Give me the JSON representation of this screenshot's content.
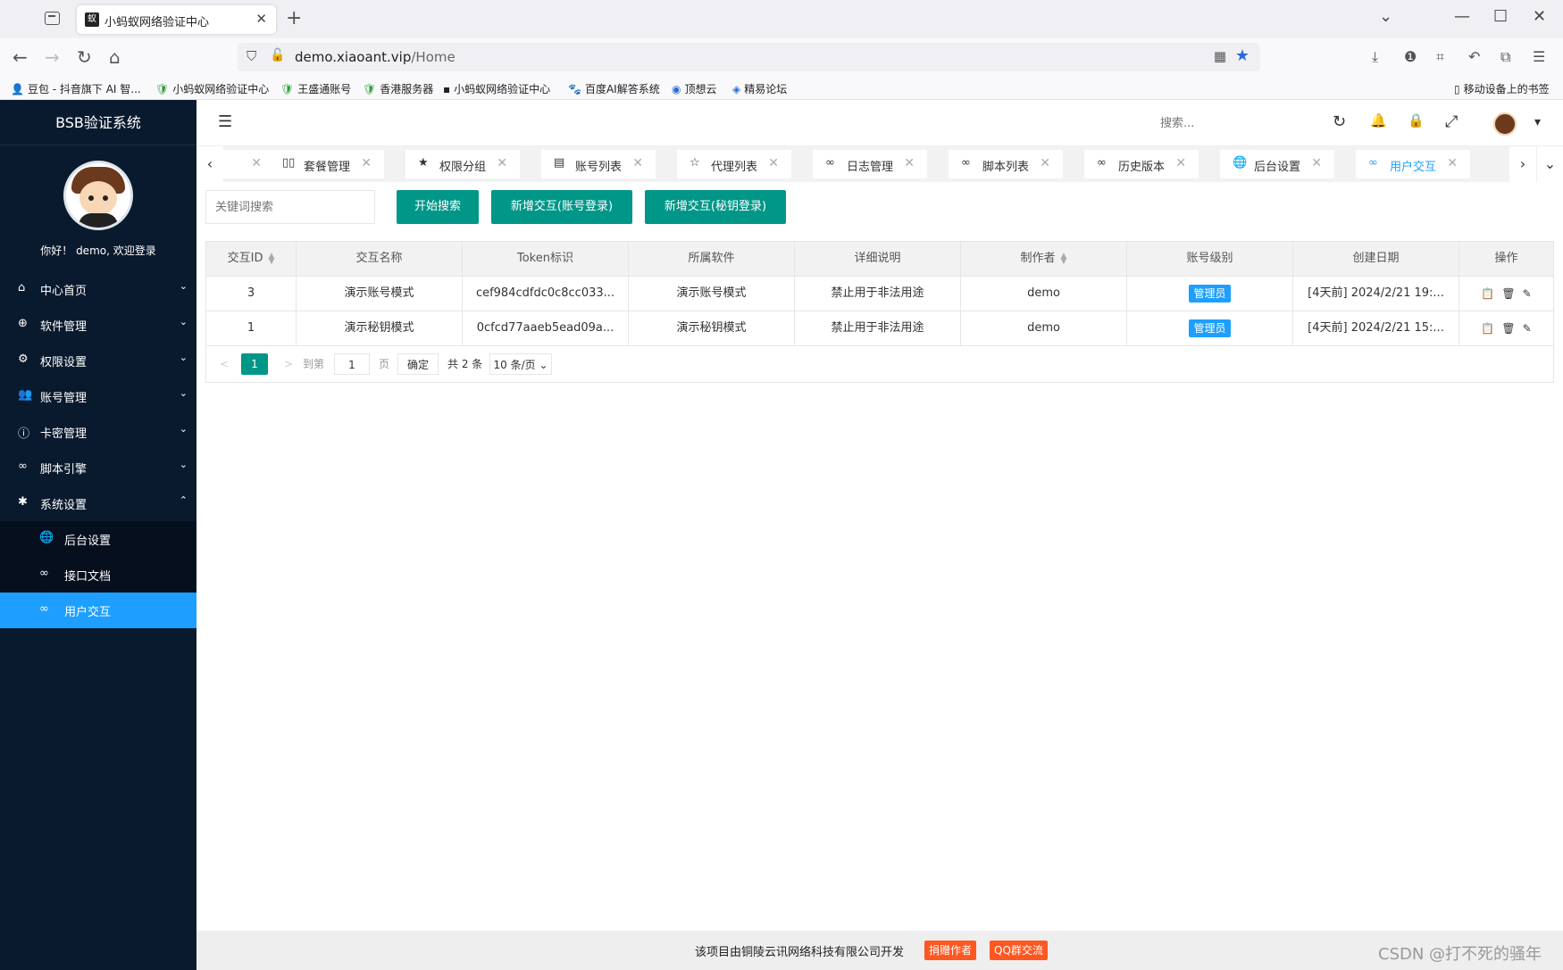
{
  "browser": {
    "tab_title": "小蚂蚁网络验证中心",
    "tab_favicon": "蚁",
    "tab_close": "✕",
    "new_tab": "+",
    "url_host": "demo.xiaoant.vip",
    "url_path": "/Home",
    "bookmarks": [
      {
        "icon": "👤",
        "label": "豆包 - 抖音旗下 AI 智..."
      },
      {
        "icon": "🛡",
        "label": "小蚂蚁网络验证中心"
      },
      {
        "icon": "🛡",
        "label": "王盛通账号"
      },
      {
        "icon": "🛡",
        "label": "香港服务器"
      },
      {
        "icon": "▪",
        "label": "小蚂蚁网络验证中心"
      },
      {
        "icon": "🐾",
        "label": "百度AI解答系统"
      },
      {
        "icon": "◉",
        "label": "顶想云"
      },
      {
        "icon": "◈",
        "label": "精易论坛"
      }
    ],
    "mobile_bookmarks": "移动设备上的书签"
  },
  "sidebar": {
    "brand": "BSB验证系统",
    "welcome": "你好！ demo, 欢迎登录",
    "menu": [
      {
        "icon": "⌂",
        "label": "中心首页",
        "arrow": "⌄"
      },
      {
        "icon": "⊕",
        "label": "软件管理",
        "arrow": "⌄"
      },
      {
        "icon": "⚙",
        "label": "权限设置",
        "arrow": "⌄"
      },
      {
        "icon": "👥",
        "label": "账号管理",
        "arrow": "⌄"
      },
      {
        "icon": "ⓘ",
        "label": "卡密管理",
        "arrow": "⌄"
      },
      {
        "icon": "∞",
        "label": "脚本引擎",
        "arrow": "⌄"
      },
      {
        "icon": "✱",
        "label": "系统设置",
        "arrow": "⌃"
      }
    ],
    "submenu": [
      {
        "icon": "🌐",
        "label": "后台设置"
      },
      {
        "icon": "∞",
        "label": "接口文档"
      },
      {
        "icon": "∞",
        "label": "用户交互"
      }
    ]
  },
  "header": {
    "menu_icon": "☰",
    "search_placeholder": "搜索...",
    "refresh_icon": "↻",
    "bell_icon": "🔔",
    "lock_icon": "🔒",
    "fullscreen_icon": "⤢",
    "caret": "▾"
  },
  "page_tabs": {
    "prev": "‹",
    "next": "›",
    "more": "⌄",
    "close": "✕",
    "items": [
      {
        "icon": "",
        "label": ""
      },
      {
        "icon": "▯▯",
        "label": "套餐管理"
      },
      {
        "icon": "★",
        "label": "权限分组"
      },
      {
        "icon": "▤",
        "label": "账号列表"
      },
      {
        "icon": "☆",
        "label": "代理列表"
      },
      {
        "icon": "∞",
        "label": "日志管理"
      },
      {
        "icon": "∞",
        "label": "脚本列表"
      },
      {
        "icon": "∞",
        "label": "历史版本"
      },
      {
        "icon": "🌐",
        "label": "后台设置"
      },
      {
        "icon": "∞",
        "label": "用户交互"
      }
    ]
  },
  "toolbar": {
    "keyword_placeholder": "关键词搜索",
    "search_button": "开始搜索",
    "add_account_button": "新增交互(账号登录)",
    "add_key_button": "新增交互(秘钥登录)"
  },
  "table": {
    "columns": [
      "交互ID",
      "交互名称",
      "Token标识",
      "所属软件",
      "详细说明",
      "制作者",
      "账号级别",
      "创建日期",
      "操作"
    ],
    "sortable": [
      true,
      false,
      false,
      false,
      false,
      true,
      false,
      false,
      false
    ],
    "rows": [
      {
        "id": "3",
        "name": "演示账号模式",
        "token": "cef984cdfdc0c8cc033...",
        "software": "演示账号模式",
        "desc": "禁止用于非法用途",
        "author": "demo",
        "level": "管理员",
        "date": "[4天前] 2024/2/21 19:..."
      },
      {
        "id": "1",
        "name": "演示秘钥模式",
        "token": "0cfcd77aaeb5ead09a...",
        "software": "演示秘钥模式",
        "desc": "禁止用于非法用途",
        "author": "demo",
        "level": "管理员",
        "date": "[4天前] 2024/2/21 15:..."
      }
    ],
    "ops": [
      "📋",
      "🗑",
      "✎"
    ]
  },
  "pager": {
    "prev": "<",
    "current": "1",
    "next": ">",
    "goto_label": "到第",
    "goto_value": "1",
    "page_label": "页",
    "confirm": "确定",
    "total": "共 2 条",
    "page_size": "10 条/页"
  },
  "footer": {
    "text": "该项目由铜陵云讯网络科技有限公司开发",
    "donate_button": "捐赠作者",
    "qq_button": "QQ群交流",
    "watermark": "CSDN @打不死的骚年"
  },
  "colors": {
    "sidebar": "#0a1a2e",
    "accent": "#1e9fff",
    "primary_button": "#009688",
    "footer_badge": "#ff5722"
  }
}
